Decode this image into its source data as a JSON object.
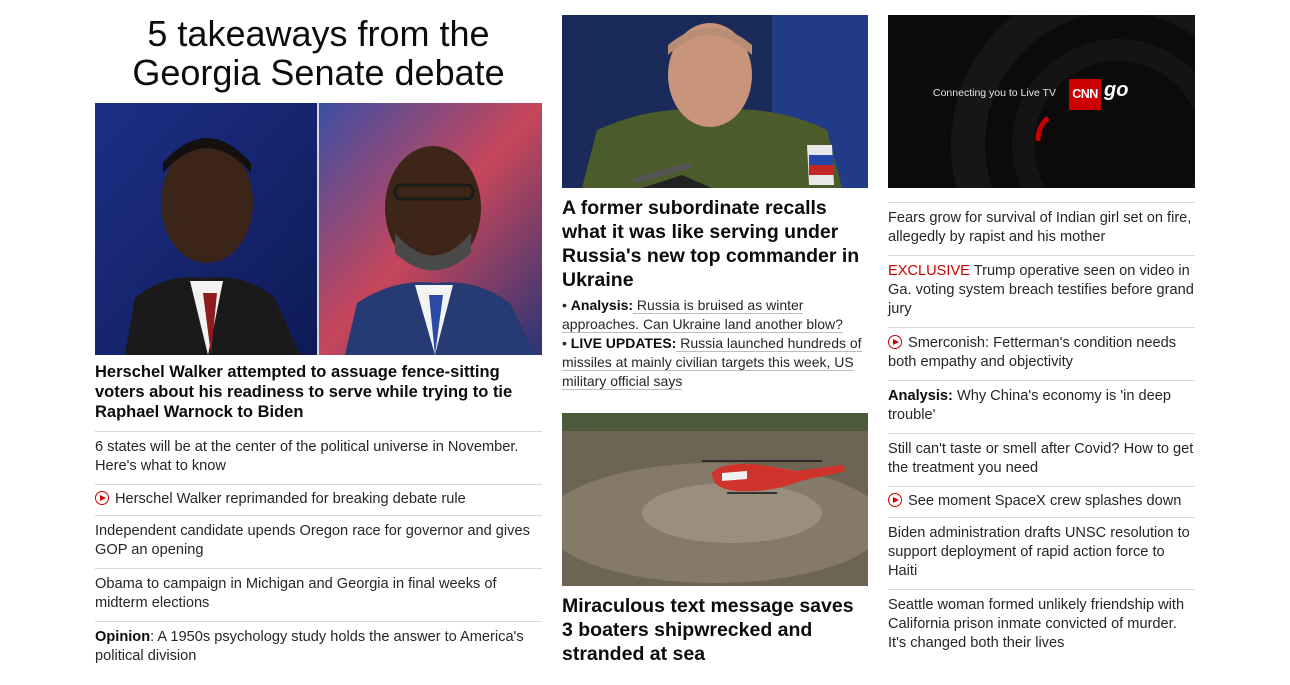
{
  "left": {
    "headline": "5 takeaways from the Georgia Senate debate",
    "lead": "Herschel Walker attempted to assuage fence-sitting voters about his readiness to serve while trying to tie Raphael Warnock to Biden",
    "items": [
      {
        "text": "6 states will be at the center of the political universe in November. Here's what to know"
      },
      {
        "text": "Herschel Walker reprimanded for breaking debate rule"
      },
      {
        "text": "Independent candidate upends Oregon race for governor and gives GOP an opening"
      },
      {
        "text": "Obama to campaign in Michigan and Georgia in final weeks of midterm elections"
      },
      {
        "prefix": "Opinion",
        "text": ": A 1950s psychology study holds the answer to America's political division"
      }
    ]
  },
  "middle": {
    "headline1": "A former subordinate recalls what it was like serving under Russia's new top commander in Ukraine",
    "bullet1_label": "Analysis:",
    "bullet1_text": " Russia is bruised as winter approaches. Can Ukraine land another blow?",
    "bullet2_label": "LIVE UPDATES:",
    "bullet2_text": " Russia launched hundreds of missiles at mainly civilian targets this week, US military official says",
    "headline2": "Miraculous text message saves 3 boaters shipwrecked and stranded at sea"
  },
  "right": {
    "video": {
      "connecting": "Connecting you to Live TV",
      "logo": "CNN",
      "go": "go"
    },
    "items": [
      {
        "text": "Fears grow for survival of Indian girl set on fire, allegedly by rapist and his mother"
      },
      {
        "label": "EXCLUSIVE",
        "text": " Trump operative seen on video in Ga. voting system breach testifies before grand jury"
      },
      {
        "text": "Smerconish: Fetterman's condition needs both empathy and objectivity"
      },
      {
        "label": "Analysis:",
        "text": " Why China's economy is 'in deep trouble'"
      },
      {
        "text": "Still can't taste or smell after Covid? How to get the treatment you need"
      },
      {
        "text": "See moment SpaceX crew splashes down"
      },
      {
        "text": "Biden administration drafts UNSC resolution to support deployment of rapid action force to Haiti"
      },
      {
        "text": "Seattle woman formed unlikely friendship with California prison inmate convicted of murder. It's changed both their lives"
      }
    ]
  },
  "colors": {
    "accent": "#cc0000",
    "divider": "#d9d9d9",
    "text": "#0c0c0c"
  }
}
